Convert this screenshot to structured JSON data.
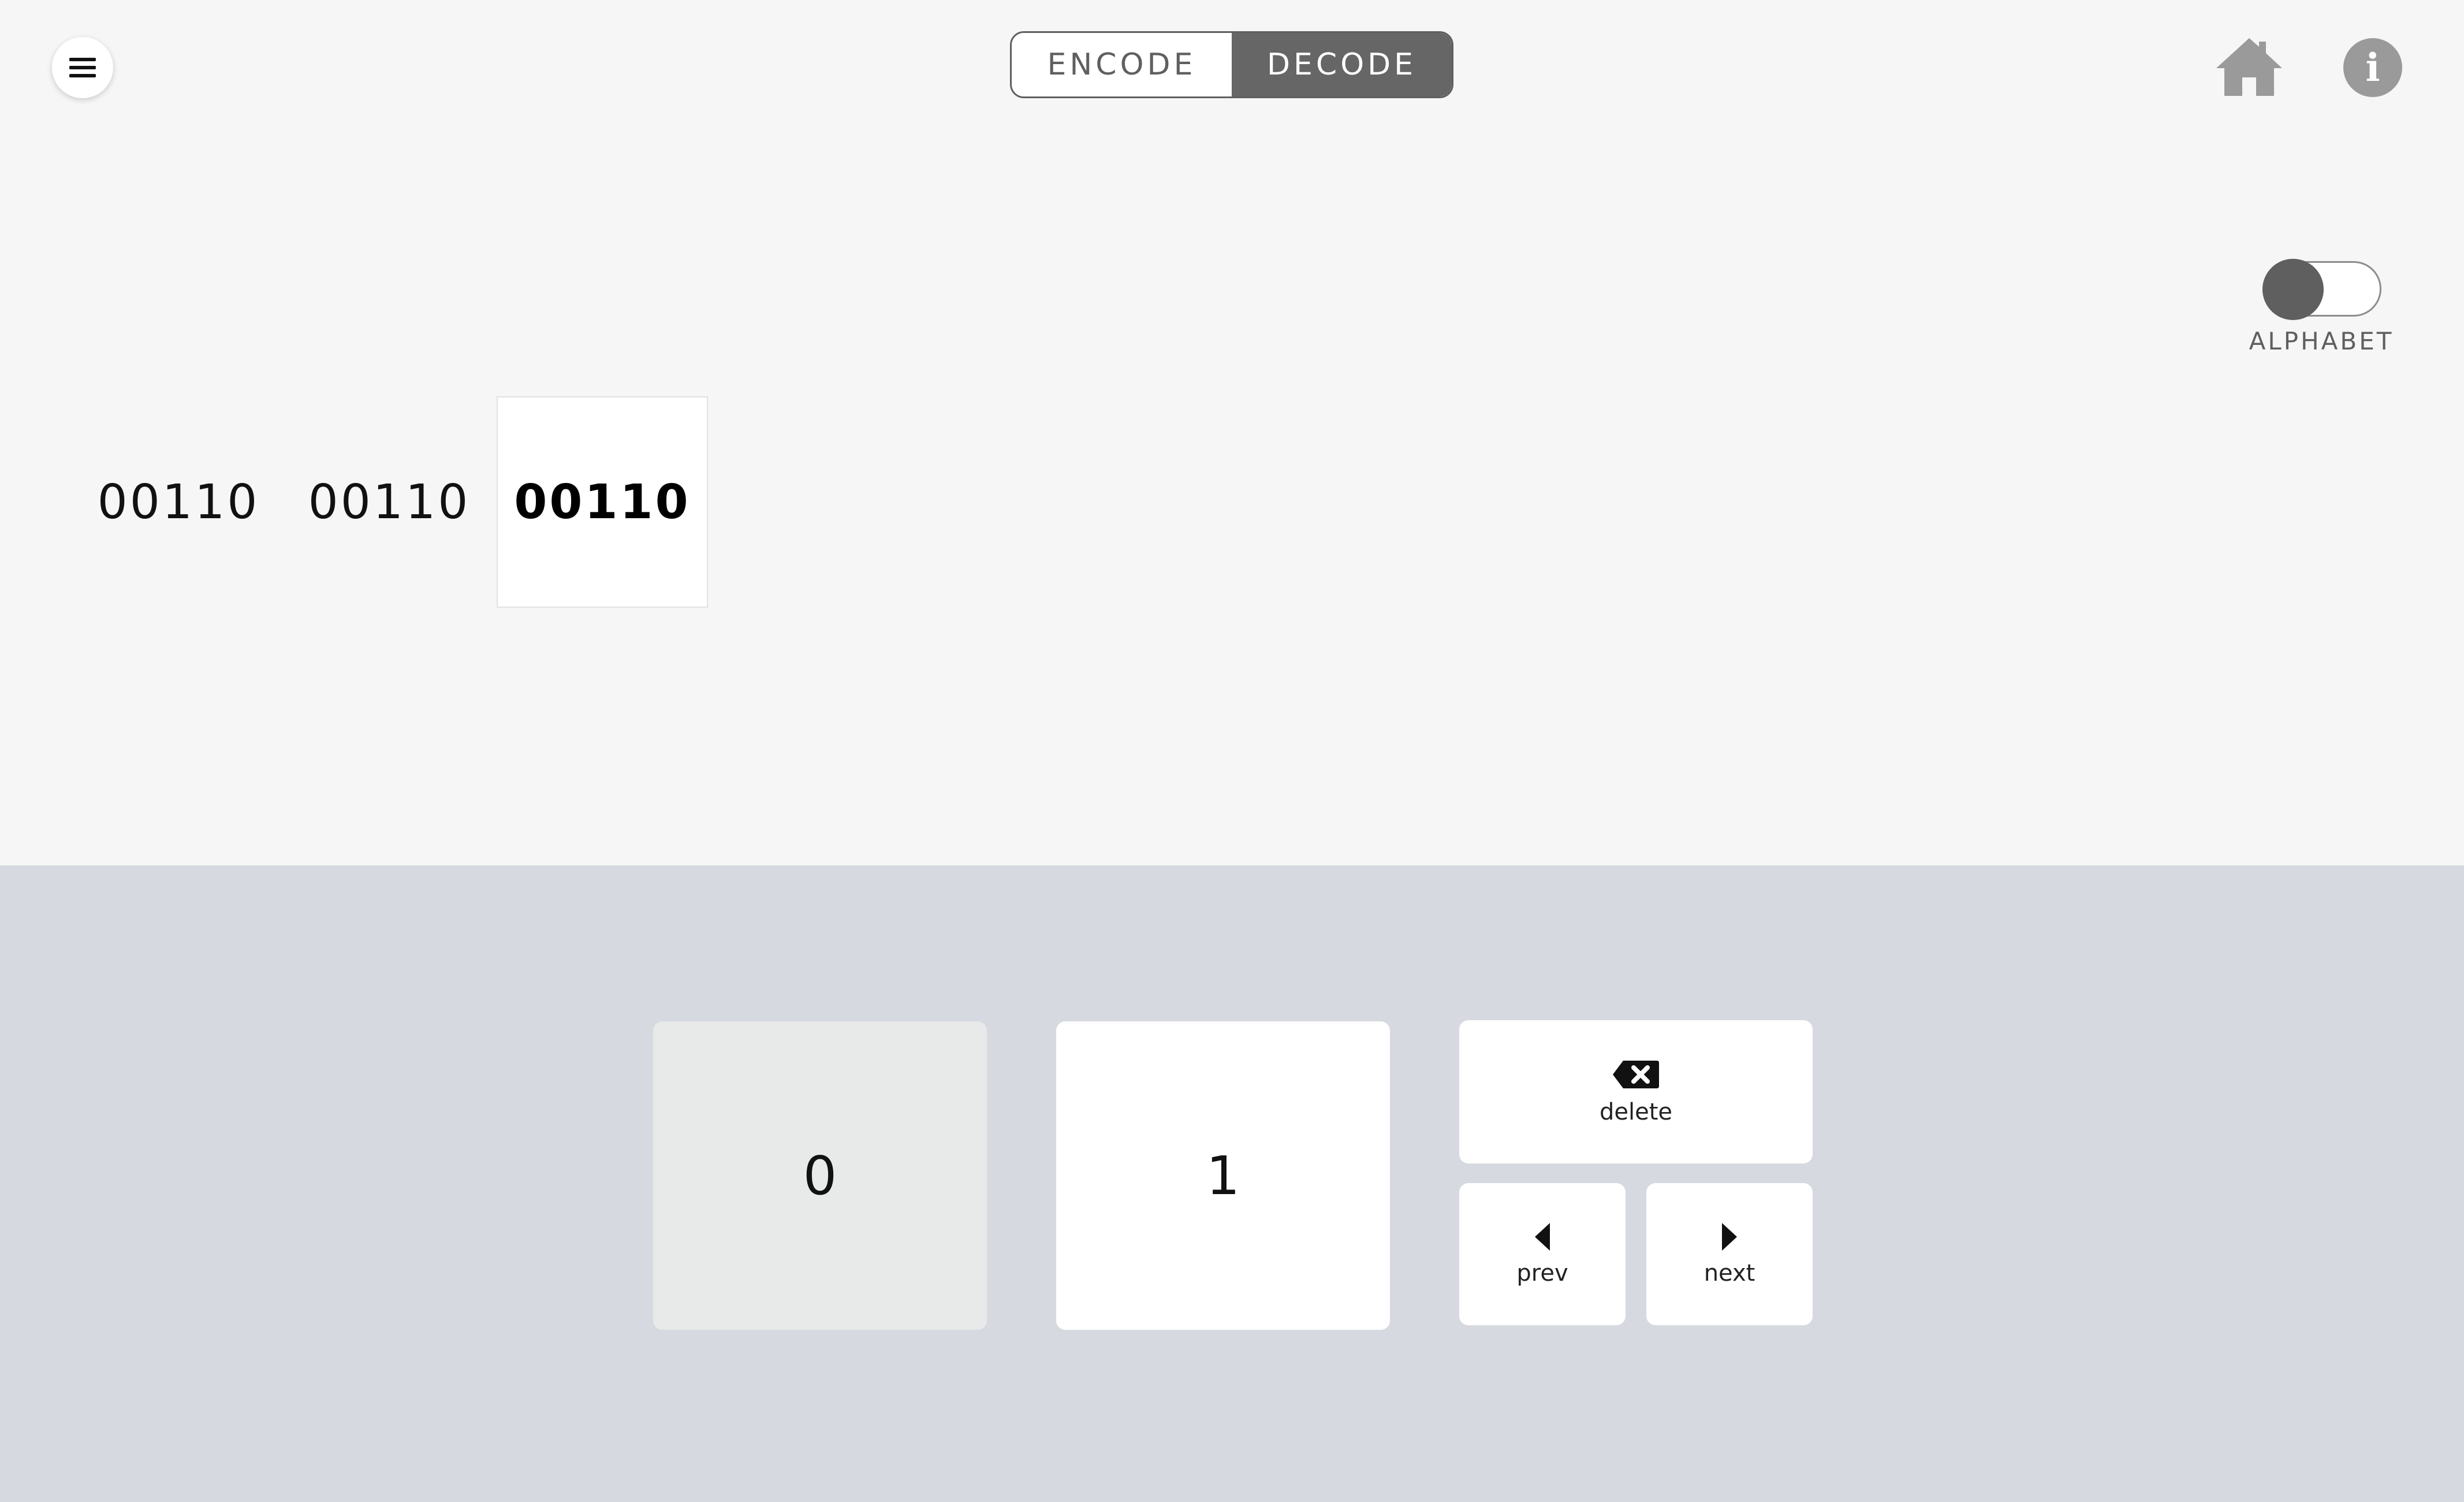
{
  "header": {
    "mode_tabs": [
      {
        "label": "ENCODE",
        "active": false
      },
      {
        "label": "DECODE",
        "active": true
      }
    ]
  },
  "toggle": {
    "label": "ALPHABET",
    "on": false
  },
  "codes": [
    {
      "value": "00110",
      "selected": false
    },
    {
      "value": "00110",
      "selected": false
    },
    {
      "value": "00110",
      "selected": true
    }
  ],
  "keypad": {
    "zero_label": "0",
    "one_label": "1",
    "delete_label": "delete",
    "prev_label": "prev",
    "next_label": "next"
  },
  "colors": {
    "page_background": "#f6f6f6",
    "keypad_background": "#d7d9e0",
    "active_tab": "#666666",
    "icon_gray": "#9a9a9a"
  },
  "icons": [
    "menu-icon",
    "home-icon",
    "info-icon",
    "delete-icon",
    "prev-arrow-icon",
    "next-arrow-icon"
  ]
}
